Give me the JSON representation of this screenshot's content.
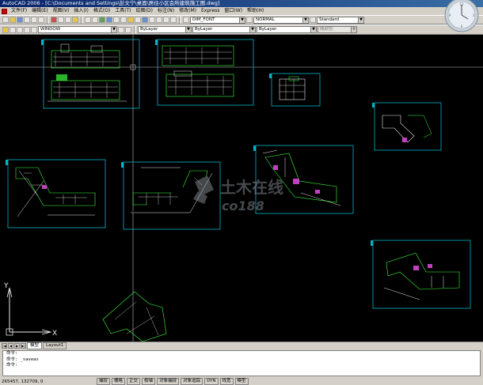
{
  "window": {
    "title": "AutoCAD 2006 - [C:\\Documents and Settings\\彭文宁\\桌面\\居住小区会所建筑施工图.dwg]"
  },
  "menu": [
    "文件(F)",
    "编辑(E)",
    "视图(V)",
    "插入(I)",
    "格式(O)",
    "工具(T)",
    "绘图(D)",
    "标注(N)",
    "修改(M)",
    "Express",
    "窗口(W)",
    "帮助(H)"
  ],
  "toolbar1": {
    "dimstyle": "DIM_FONT",
    "textstyle": "NORMAL",
    "tablestyle": "Standard"
  },
  "toolbar2": {
    "layer": "WINDOW",
    "color": "ByLayer",
    "linetype": "ByLayer",
    "lineweight": "ByLayer",
    "plotstyle": "随颜色"
  },
  "tabs": [
    "模型",
    "Layout1"
  ],
  "command_lines": [
    "命令:",
    "命令: _saveas",
    "命令:"
  ],
  "status": {
    "coords": "265457, 132709, 0",
    "buttons": [
      "捕捉",
      "栅格",
      "正交",
      "极轴",
      "对象捕捉",
      "对象追踪",
      "DYN",
      "线宽",
      "模型"
    ]
  },
  "ucs": {
    "x_label": "X",
    "y_label": "Y"
  },
  "watermark": {
    "brand": "土木在线",
    "domain": "co188"
  },
  "colors": {
    "canvas": "#000000",
    "frame": "#00b4c8",
    "drawing_green": "#3cff3c",
    "drawing_white": "#e8e8e8",
    "crosshair": "#bfbfbf"
  }
}
